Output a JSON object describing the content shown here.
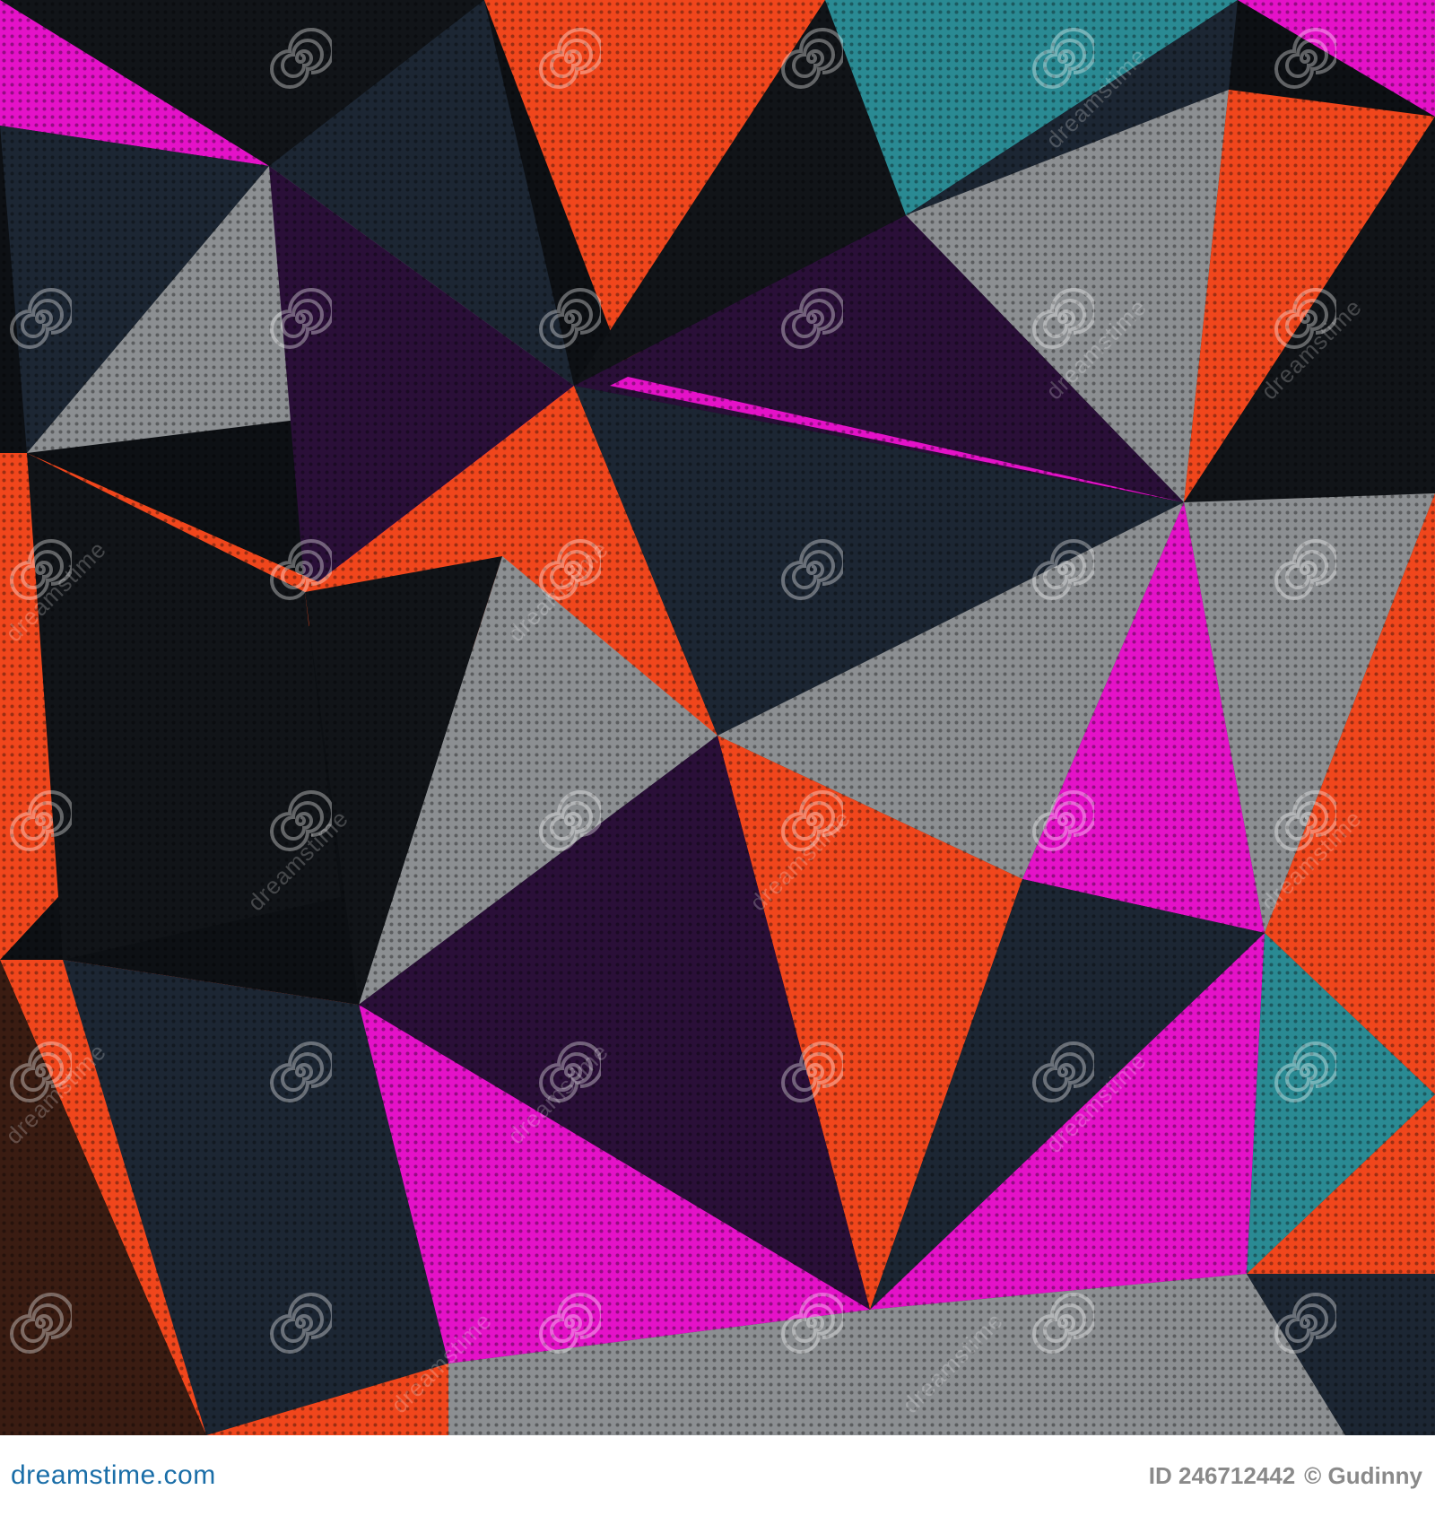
{
  "artwork": {
    "description_icon": "low-poly-halftone-pattern",
    "palette": {
      "dark": "#111418",
      "navy": "#1c2633",
      "teal": "#2a8a93",
      "magenta": "#e412c8",
      "orange": "#f0461c",
      "gray": "#8c8f92",
      "purple": "#2a0f38",
      "brown": "#3a1c12"
    }
  },
  "watermark": {
    "text": "dreamstime",
    "icon": "dreamstime-spiral-icon"
  },
  "footer": {
    "logo_text": "dreamstime.com",
    "id_text": "ID 246712442",
    "credit_text": "© Gudinny"
  }
}
